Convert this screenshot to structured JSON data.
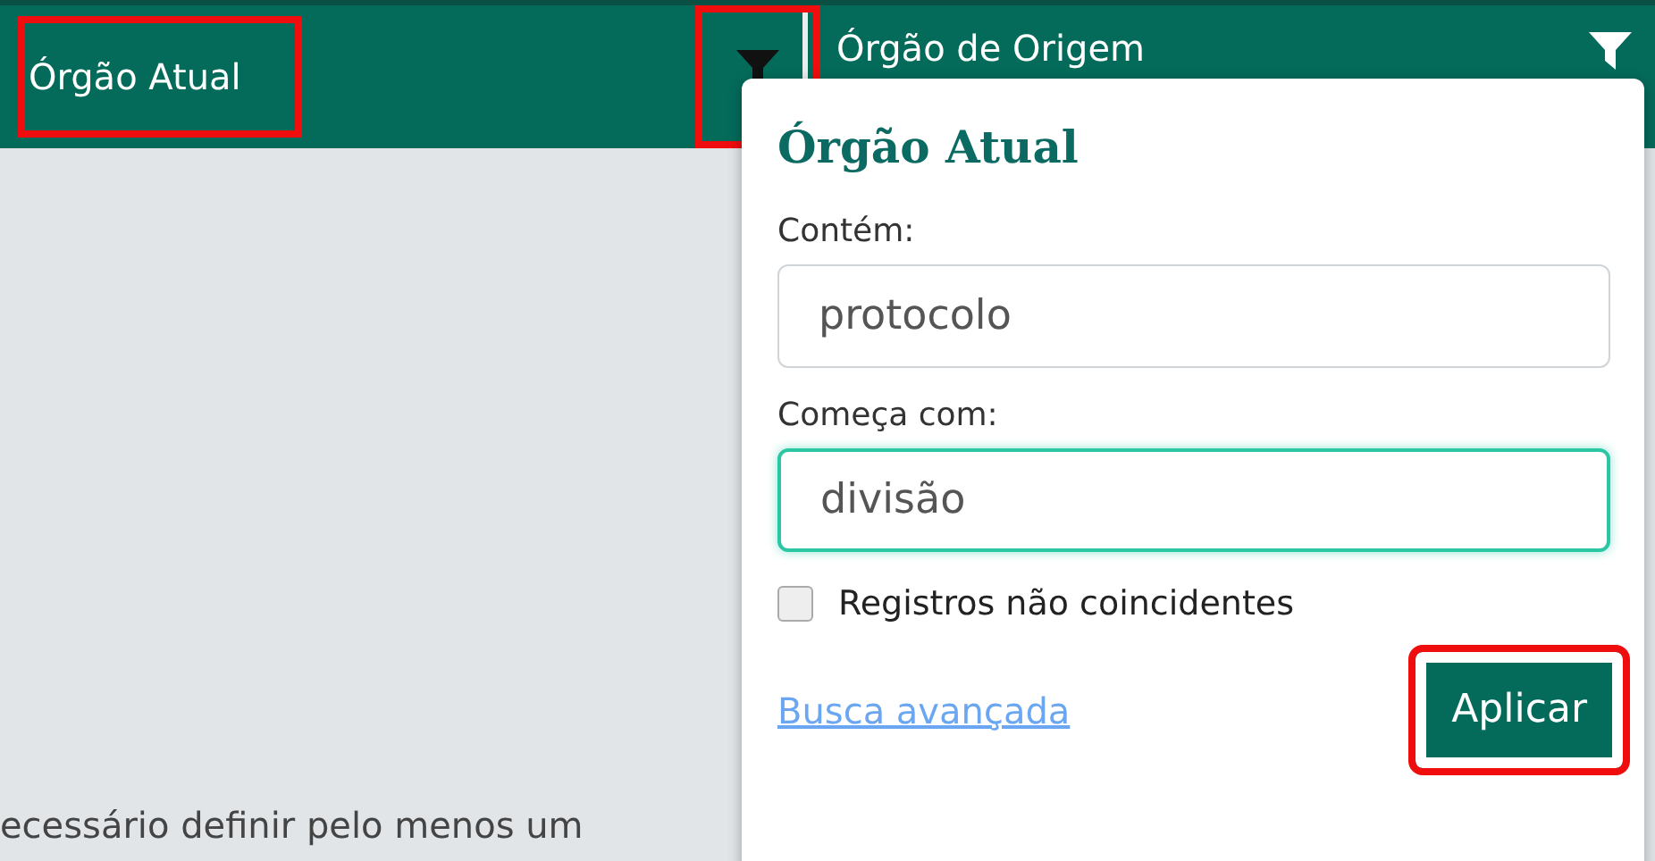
{
  "columns": [
    {
      "title": "Órgão Atual",
      "title_highlighted": true,
      "filter_highlighted": true
    },
    {
      "title": "Órgão de Origem",
      "title_highlighted": false,
      "filter_highlighted": false
    }
  ],
  "footer_text": "ecessário definir pelo menos um",
  "filter_popup": {
    "title": "Órgão Atual",
    "fields": [
      {
        "label": "Contém:",
        "value": "protocolo",
        "focused": false
      },
      {
        "label": "Começa com:",
        "value": "divisão",
        "focused": true
      }
    ],
    "checkbox": {
      "label": "Registros não coincidentes",
      "checked": false
    },
    "link": "Busca avançada",
    "button": {
      "label": "Aplicar",
      "highlighted": true
    }
  }
}
